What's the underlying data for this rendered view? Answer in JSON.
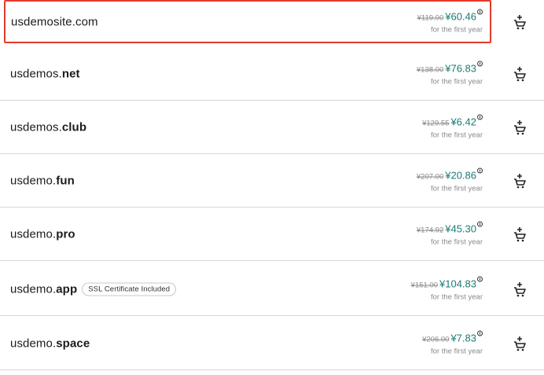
{
  "results": [
    {
      "name": "usdemosite",
      "tld": "com",
      "badge": "",
      "old_price": "¥119.00",
      "price": "¥60.46",
      "note": "for the first year",
      "selected": true
    },
    {
      "name": "usdemos.",
      "tld": "net",
      "badge": "",
      "old_price": "¥138.00",
      "price": "¥76.83",
      "note": "for the first year",
      "selected": false
    },
    {
      "name": "usdemos.",
      "tld": "club",
      "badge": "",
      "old_price": "¥129.55",
      "price": "¥6.42",
      "note": "for the first year",
      "selected": false
    },
    {
      "name": "usdemo.",
      "tld": "fun",
      "badge": "",
      "old_price": "¥207.00",
      "price": "¥20.86",
      "note": "for the first year",
      "selected": false
    },
    {
      "name": "usdemo.",
      "tld": "pro",
      "badge": "",
      "old_price": "¥174.92",
      "price": "¥45.30",
      "note": "for the first year",
      "selected": false
    },
    {
      "name": "usdemo.",
      "tld": "app",
      "badge": "SSL Certificate Included",
      "old_price": "¥151.00",
      "price": "¥104.83",
      "note": "for the first year",
      "selected": false
    },
    {
      "name": "usdemo.",
      "tld": "space",
      "badge": "",
      "old_price": "¥206.00",
      "price": "¥7.83",
      "note": "for the first year",
      "selected": false
    }
  ],
  "colors": {
    "price": "#1a7a74",
    "selected_border": "#e43a2a",
    "divider": "#d7d7d7"
  },
  "icons": {
    "cart": "add-to-cart-icon",
    "info": "info-icon"
  }
}
